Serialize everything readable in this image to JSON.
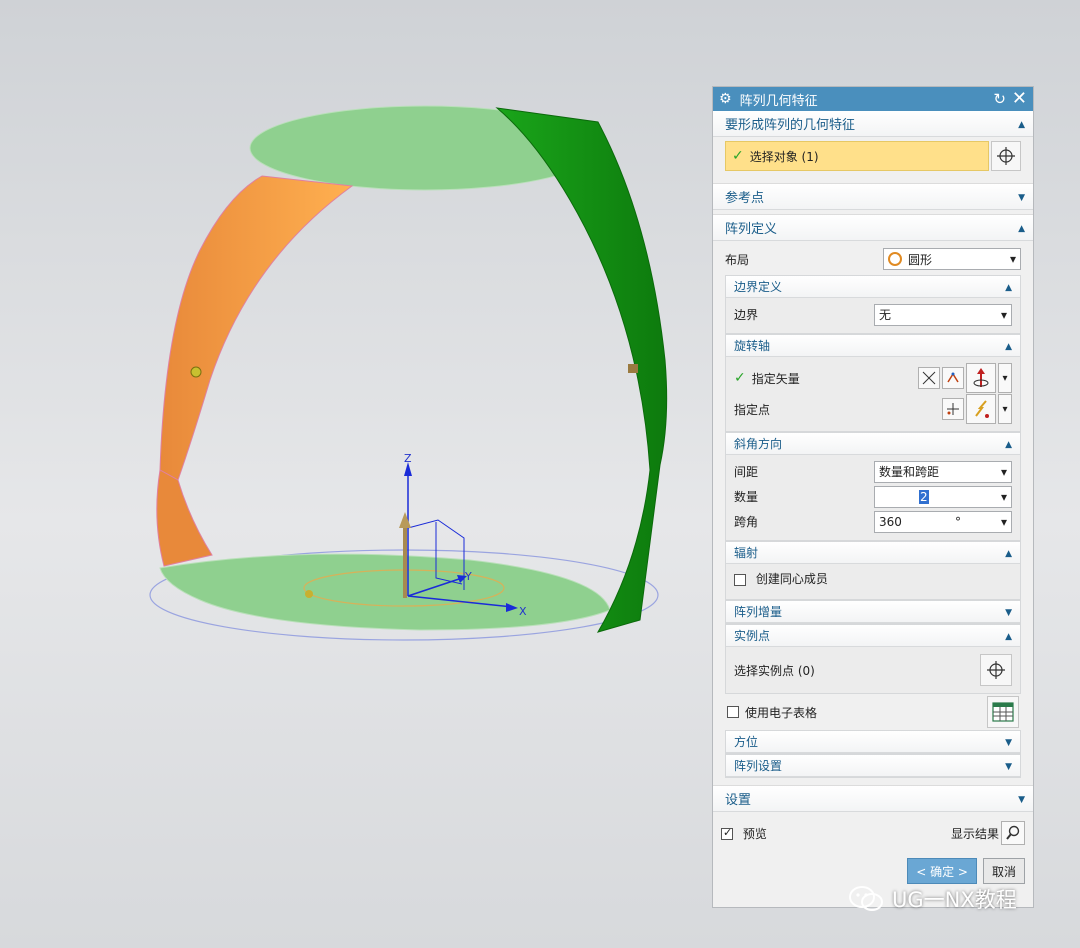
{
  "dialog": {
    "title": "阵列几何特征",
    "sections": {
      "features": {
        "header": "要形成阵列的几何特征",
        "select_label": "选择对象 (1)"
      },
      "reference": {
        "header": "参考点"
      },
      "definition": {
        "header": "阵列定义",
        "layout_label": "布局",
        "layout_value": "圆形",
        "boundary": {
          "header": "边界定义",
          "label": "边界",
          "value": "无"
        },
        "rotation": {
          "header": "旋转轴",
          "vector_label": "指定矢量",
          "point_label": "指定点"
        },
        "angle_direction": {
          "header": "斜角方向",
          "spacing_label": "间距",
          "spacing_value": "数量和跨距",
          "count_label": "数量",
          "count_value": "2",
          "span_label": "跨角",
          "span_value": "360",
          "span_unit": "°"
        },
        "radial": {
          "header": "辐射",
          "concentric_label": "创建同心成员"
        },
        "increment": {
          "header": "阵列增量"
        },
        "instance_point": {
          "header": "实例点",
          "select_label": "选择实例点 (0)"
        },
        "spreadsheet_label": "使用电子表格",
        "orientation": {
          "header": "方位"
        },
        "pattern_settings": {
          "header": "阵列设置"
        }
      },
      "settings": {
        "header": "设置"
      }
    },
    "preview_label": "预览",
    "show_result_label": "显示结果",
    "ok_label": "< 确定 >",
    "cancel_label": "取消"
  },
  "viewport": {
    "axes": {
      "x": "X",
      "y": "Y",
      "z": "Z"
    }
  },
  "watermark": "UG一NX教程",
  "colors": {
    "title_bar": "#4a8fbd",
    "header_text": "#1a5d8a",
    "select_highlight": "#ffe08a",
    "orange_surface": "#f0a050",
    "green_surface": "#1f9a1f",
    "light_green": "#8fd08f"
  }
}
